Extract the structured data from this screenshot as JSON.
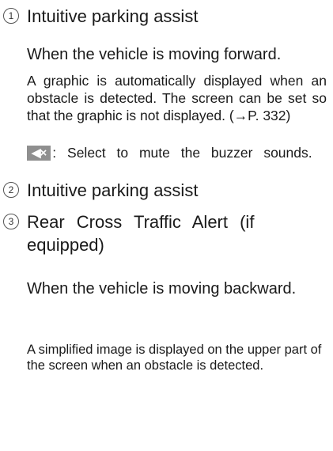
{
  "items": [
    {
      "number": "1",
      "title": "Intuitive parking assist",
      "forward_condition": "When the vehicle is moving forward.",
      "description": "A graphic is automatically displayed when an obstacle is detected. The screen can be set so that the graphic is not displayed. (→P. 332)",
      "mute": {
        "icon": "mute-speaker-icon",
        "symbol": "◀×",
        "text": ": Select to mute the buzzer sounds."
      }
    },
    {
      "number": "2",
      "title": "Intuitive parking assist"
    },
    {
      "number": "3",
      "title": "Rear Cross Traffic Alert (if equipped)",
      "backward_condition": "When the vehicle is moving backward.",
      "description": "A simplified image is displayed on the upper part of the screen when an obstacle is detected."
    }
  ]
}
